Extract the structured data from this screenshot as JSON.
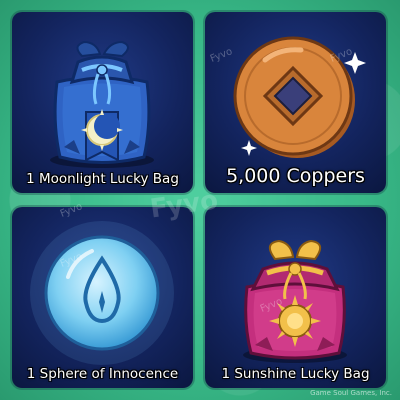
{
  "items": [
    {
      "label": "1 Moonlight Lucky Bag",
      "icon": "moonlight-bag-icon"
    },
    {
      "label": "5,000 Coppers",
      "icon": "copper-coin-icon"
    },
    {
      "label": "1 Sphere of Innocence",
      "icon": "water-sphere-icon"
    },
    {
      "label": "1 Sunshine Lucky Bag",
      "icon": "sunshine-bag-icon"
    }
  ],
  "watermark": "Fyvo",
  "copyright": "Game Soul Games, Inc.",
  "colors": {
    "background": "#3cc08e",
    "card": "#13245e",
    "moonlight_bag": "#2f63c4",
    "copper": "#d9853c",
    "sphere": "#7fd0f2",
    "sunshine_bag": "#c42f7e",
    "gold": "#f2c04a"
  }
}
